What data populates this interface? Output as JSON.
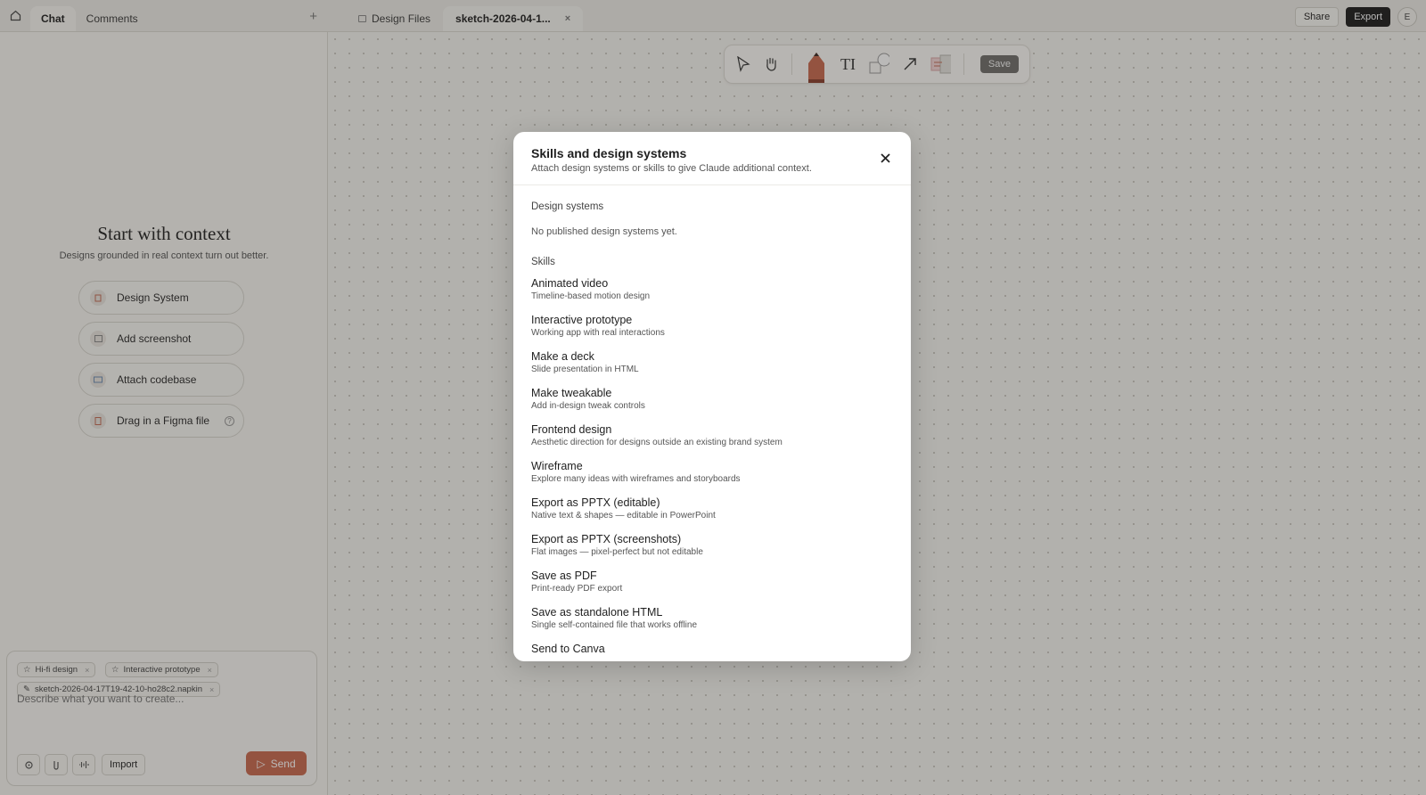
{
  "left_tabs": {
    "chat": "Chat",
    "comments": "Comments",
    "add": "+"
  },
  "file_tabs": {
    "design_files": "Design Files",
    "current": "sketch-2026-04-1...",
    "close": "×"
  },
  "top_actions": {
    "share": "Share",
    "export": "Export",
    "avatar": "E"
  },
  "toolbar": {
    "save": "Save",
    "text_tool": "TI"
  },
  "context": {
    "title": "Start with context",
    "subtitle": "Designs grounded in real context turn out better.",
    "buttons": [
      {
        "label": "Design System",
        "icon": "book-icon"
      },
      {
        "label": "Add screenshot",
        "icon": "image-icon"
      },
      {
        "label": "Attach codebase",
        "icon": "folder-icon"
      },
      {
        "label": "Drag in a Figma file",
        "icon": "file-icon"
      }
    ],
    "help": "?"
  },
  "composer": {
    "chips": [
      {
        "label": "Hi-fi design",
        "icon": "star-icon"
      },
      {
        "label": "Interactive prototype",
        "icon": "star-icon"
      },
      {
        "label": "sketch-2026-04-17T19-42-10-ho28c2.napkin",
        "icon": "pencil-icon"
      }
    ],
    "chip_remove": "×",
    "placeholder": "Describe what you want to create...",
    "import": "Import",
    "send": "Send"
  },
  "modal": {
    "title": "Skills and design systems",
    "subtitle": "Attach design systems or skills to give Claude additional context.",
    "close": "×",
    "design_systems_label": "Design systems",
    "design_systems_empty": "No published design systems yet.",
    "skills_label": "Skills",
    "skills": [
      {
        "name": "Animated video",
        "desc": "Timeline-based motion design"
      },
      {
        "name": "Interactive prototype",
        "desc": "Working app with real interactions"
      },
      {
        "name": "Make a deck",
        "desc": "Slide presentation in HTML"
      },
      {
        "name": "Make tweakable",
        "desc": "Add in-design tweak controls"
      },
      {
        "name": "Frontend design",
        "desc": "Aesthetic direction for designs outside an existing brand system"
      },
      {
        "name": "Wireframe",
        "desc": "Explore many ideas with wireframes and storyboards"
      },
      {
        "name": "Export as PPTX (editable)",
        "desc": "Native text & shapes — editable in PowerPoint"
      },
      {
        "name": "Export as PPTX (screenshots)",
        "desc": "Flat images — pixel-perfect but not editable"
      },
      {
        "name": "Save as PDF",
        "desc": "Print-ready PDF export"
      },
      {
        "name": "Save as standalone HTML",
        "desc": "Single self-contained file that works offline"
      },
      {
        "name": "Send to Canva",
        "desc": ""
      }
    ]
  },
  "colors": {
    "accent": "#c8694e",
    "dark_button": "#1c1c1c",
    "canvas": "#f4f3ef"
  }
}
